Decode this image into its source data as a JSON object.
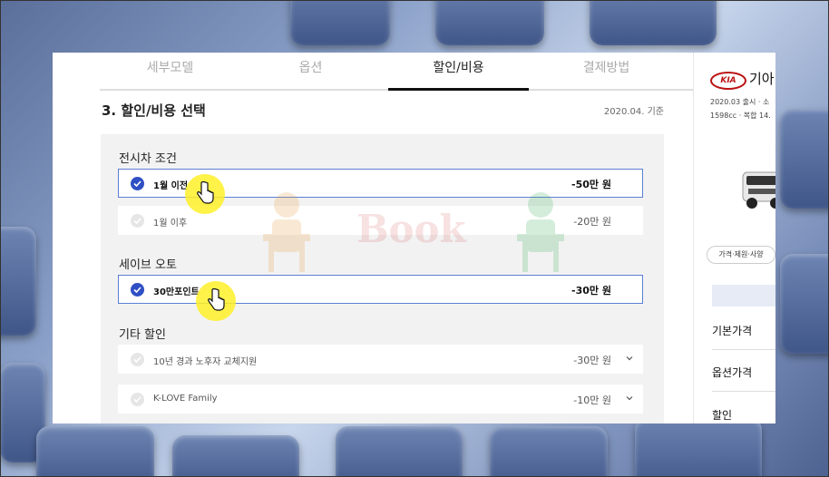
{
  "tabs": [
    {
      "label": "세부모델"
    },
    {
      "label": "옵션"
    },
    {
      "label": "할인/비용"
    },
    {
      "label": "결제방법"
    }
  ],
  "section": {
    "title": "3. 할인/비용 선택",
    "base_date": "2020.04. 기준"
  },
  "groups": {
    "showroom": {
      "label": "전시차 조건",
      "options": [
        {
          "label": "1월 이전",
          "price": "-50만 원",
          "selected": true
        },
        {
          "label": "1월 이후",
          "price": "-20만 원",
          "selected": false
        }
      ]
    },
    "save_auto": {
      "label": "세이브 오토",
      "options": [
        {
          "label": "30만포인트",
          "price": "-30만 원",
          "selected": true
        }
      ]
    },
    "other": {
      "label": "기타 할인",
      "options": [
        {
          "label": "10년 경과 노후자 교체지원",
          "price": "-30만 원",
          "selected": false
        },
        {
          "label": "K-LOVE Family",
          "price": "-10만 원",
          "selected": false
        }
      ]
    }
  },
  "watermark": "Book",
  "summary": {
    "logo": "KIA",
    "brand": "기아",
    "spec_line1": "2020.03 출시 · 소",
    "spec_line2": "1598cc · 복합 14.",
    "price_chip": "가격·제원·사양",
    "items": [
      {
        "label": "기본가격"
      },
      {
        "label": "옵션가격"
      },
      {
        "label": "할인"
      }
    ]
  },
  "colors": {
    "accent": "#2f4fc4",
    "cursor_highlight": "#fff028",
    "brand_red": "#bb1111"
  }
}
